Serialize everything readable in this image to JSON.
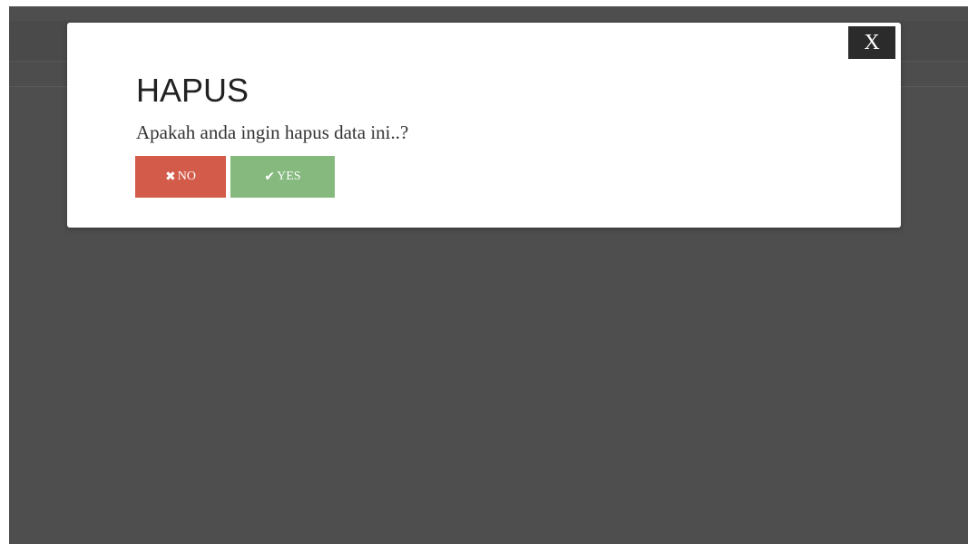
{
  "modal": {
    "close_label": "X",
    "title": "HAPUS",
    "message": "Apakah anda ingin hapus data ini..?",
    "buttons": {
      "no": {
        "icon": "times-icon",
        "glyph": "✖",
        "label": "NO",
        "color": "#d35b4a"
      },
      "yes": {
        "icon": "check-icon",
        "glyph": "✔",
        "label": "YES",
        "color": "#85b97e"
      }
    }
  },
  "colors": {
    "backdrop": "#4e4e4e",
    "modal_bg": "#ffffff",
    "close_bg": "#2b2b2b"
  }
}
